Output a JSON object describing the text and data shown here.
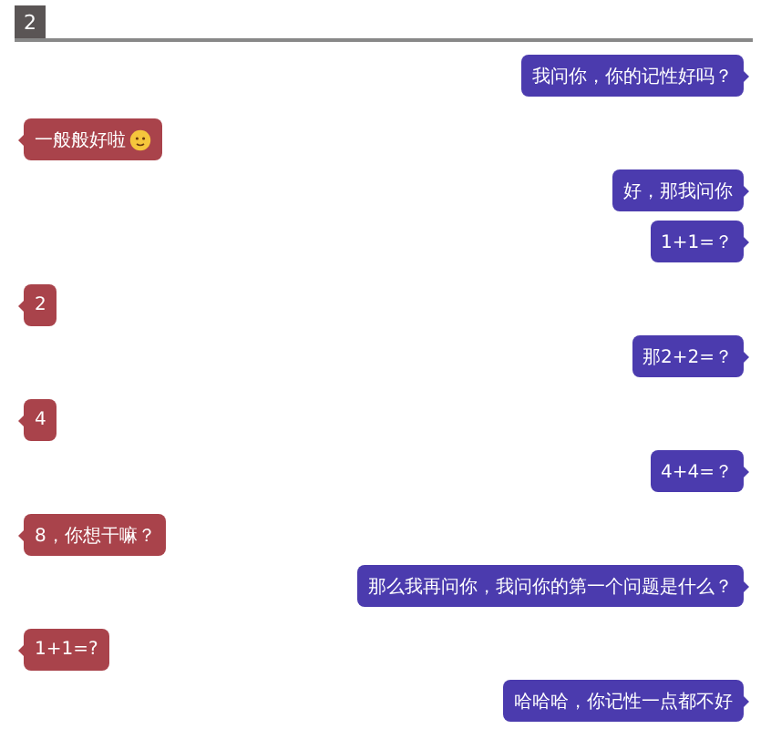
{
  "header": {
    "label": "2"
  },
  "messages": [
    {
      "kind": "sent",
      "text": "我问你，你的记性好吗？",
      "emoji": false
    },
    {
      "kind": "received",
      "text": "一般般好啦",
      "emoji": true
    },
    {
      "kind": "sent",
      "text": "好，那我问你",
      "emoji": false
    },
    {
      "kind": "sent",
      "text": "1+1=？",
      "emoji": false
    },
    {
      "kind": "received",
      "text": "2",
      "emoji": false
    },
    {
      "kind": "sent",
      "text": "那2+2=？",
      "emoji": false
    },
    {
      "kind": "received",
      "text": "4",
      "emoji": false
    },
    {
      "kind": "sent",
      "text": "4+4=？",
      "emoji": false
    },
    {
      "kind": "received",
      "text": "8，你想干嘛？",
      "emoji": false
    },
    {
      "kind": "sent",
      "text": "那么我再问你，我问你的第一个问题是什么？",
      "emoji": false
    },
    {
      "kind": "received",
      "text": "1+1=?",
      "emoji": false
    },
    {
      "kind": "sent",
      "text": "哈哈哈，你记性一点都不好",
      "emoji": false
    }
  ]
}
